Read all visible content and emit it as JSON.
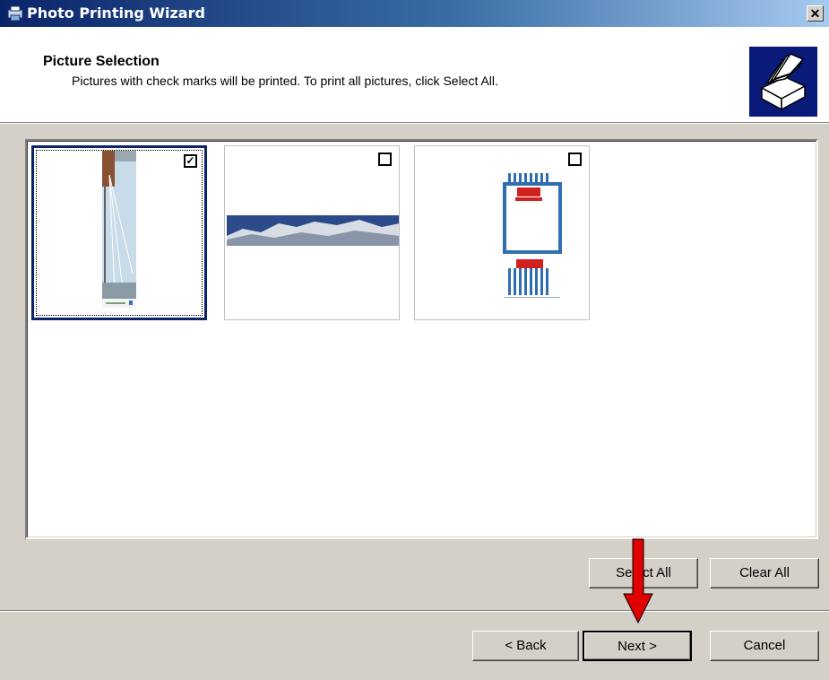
{
  "window": {
    "title": "Photo Printing Wizard",
    "close_glyph": "✕"
  },
  "header": {
    "title": "Picture Selection",
    "subtitle": "Pictures with check marks will be printed.  To print all pictures, click Select All.",
    "icon": "printer-icon"
  },
  "pictures": [
    {
      "name": "bridge-photo",
      "checked": true,
      "check_glyph": "✓"
    },
    {
      "name": "mountain-panorama",
      "checked": false,
      "check_glyph": ""
    },
    {
      "name": "blue-striped-poster",
      "checked": false,
      "check_glyph": ""
    }
  ],
  "selection_buttons": {
    "select_all": "Select All",
    "clear_all": "Clear All"
  },
  "nav_buttons": {
    "back": "< Back",
    "next": "Next >",
    "cancel": "Cancel"
  },
  "colors": {
    "title_bar": "#0a246a",
    "dialog_bg": "#d4d0c8",
    "annotation_arrow": "#e00000"
  }
}
